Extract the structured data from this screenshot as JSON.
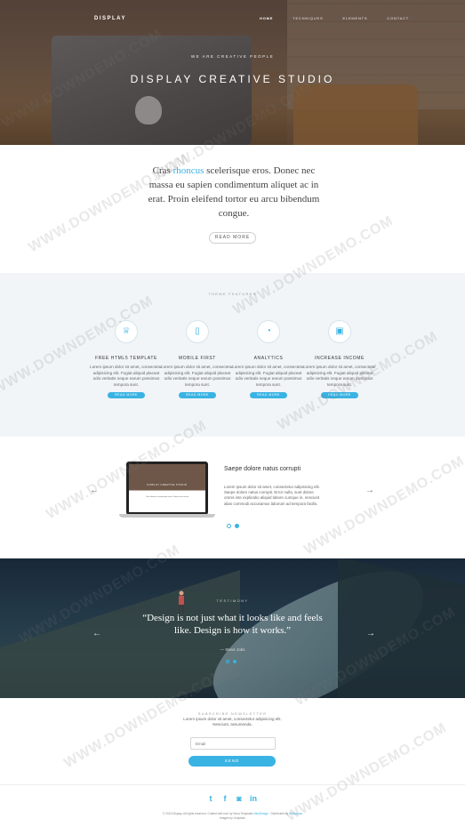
{
  "colors": {
    "accent": "#39b3e3",
    "features_bg": "#f1f5f7",
    "text_dark": "#333333"
  },
  "header": {
    "brand": "DISPLAY",
    "nav": [
      "HOME",
      "TECHNIQUES",
      "ELEMENTS",
      "CONTACT"
    ],
    "kicker": "WE ARE CREATIVE PEOPLE",
    "title": "DISPLAY CREATIVE STUDIO"
  },
  "intro": {
    "text_before": "Cras ",
    "highlight": "rhoncus",
    "text_after": " scelerisque eros. Donec nec massa eu sapien condimentum aliquet ac in erat. Proin eleifend tortor eu arcu bibendum congue.",
    "button": "READ MORE"
  },
  "features": {
    "title": "THEME FEATURES",
    "items": [
      {
        "icon": "crown-icon",
        "glyph": "♕",
        "title": "FREE HTML5 TEMPLATE",
        "text": "Lorem ipsum dolor sit amet, consectetur adipisicing elit. Fugiat aliquid placeat odio veritatis neque earum possimus tempora sunt.",
        "button": "READ MORE"
      },
      {
        "icon": "mobile-icon",
        "glyph": "▯",
        "title": "MOBILE FIRST",
        "text": "Lorem ipsum dolor sit amet, consectetur adipisicing elit. Fugiat aliquid placeat odio veritatis neque earum possimus tempora sunt.",
        "button": "READ MORE"
      },
      {
        "icon": "pie-chart-icon",
        "glyph": "◔",
        "title": "ANALYTICS",
        "text": "Lorem ipsum dolor sit amet, consectetur adipisicing elit. Fugiat aliquid placeat odio veritatis neque earum possimus tempora sunt.",
        "button": "READ MORE"
      },
      {
        "icon": "wallet-icon",
        "glyph": "▣",
        "title": "INCREASE INCOME",
        "text": "Lorem ipsum dolor sit amet, consectetur adipisicing elit. Fugiat aliquid placeat odio veritatis neque earum possimus tempora sunt.",
        "button": "READ MORE"
      }
    ]
  },
  "slider": {
    "prev": "←",
    "next": "→",
    "monitor_title": "DISPLAY CREATIVE STUDIO",
    "monitor_text": "Cras rhoncus scelerisque eros. Donec nec massa",
    "title": "Saepe dolore natus corrupti",
    "text": "Lorem ipsum dolor sit amet, consectetur adipisicing elit. Saepe dolore natus corrupti. Error nulla, sunt dolore omnis iste explicabo aliquid labore cumque in, nesciunt alias commodi accusamus laborum ad tempora facilis."
  },
  "testimonial": {
    "kicker": "TESTIMONY",
    "quote": "“Design is not just what it looks like and feels like. Design is how it works.”",
    "author": "— Steve Jobs",
    "prev": "←",
    "next": "→"
  },
  "newsletter": {
    "title": "SUBSCRIBE NEWSLETTER",
    "text": "Lorem ipsum dolor sit amet, consectetur adipisicing elit. Nesciunt, assumenda.",
    "placeholder": "Email",
    "button": "SEND"
  },
  "footer": {
    "social": [
      "t",
      "f",
      "◙",
      "in"
    ],
    "copy_line1_a": "© 2016 Display. All rights reserved. Crafted with love by Nova Templates ",
    "copy_link1": "MoxDesign",
    "copy_line1_b": " · Distributed by ",
    "copy_link2": "W3layouts",
    "copy_line2": "Images by Unsplash"
  },
  "watermark": "WWW.DOWNDEMO.COM"
}
